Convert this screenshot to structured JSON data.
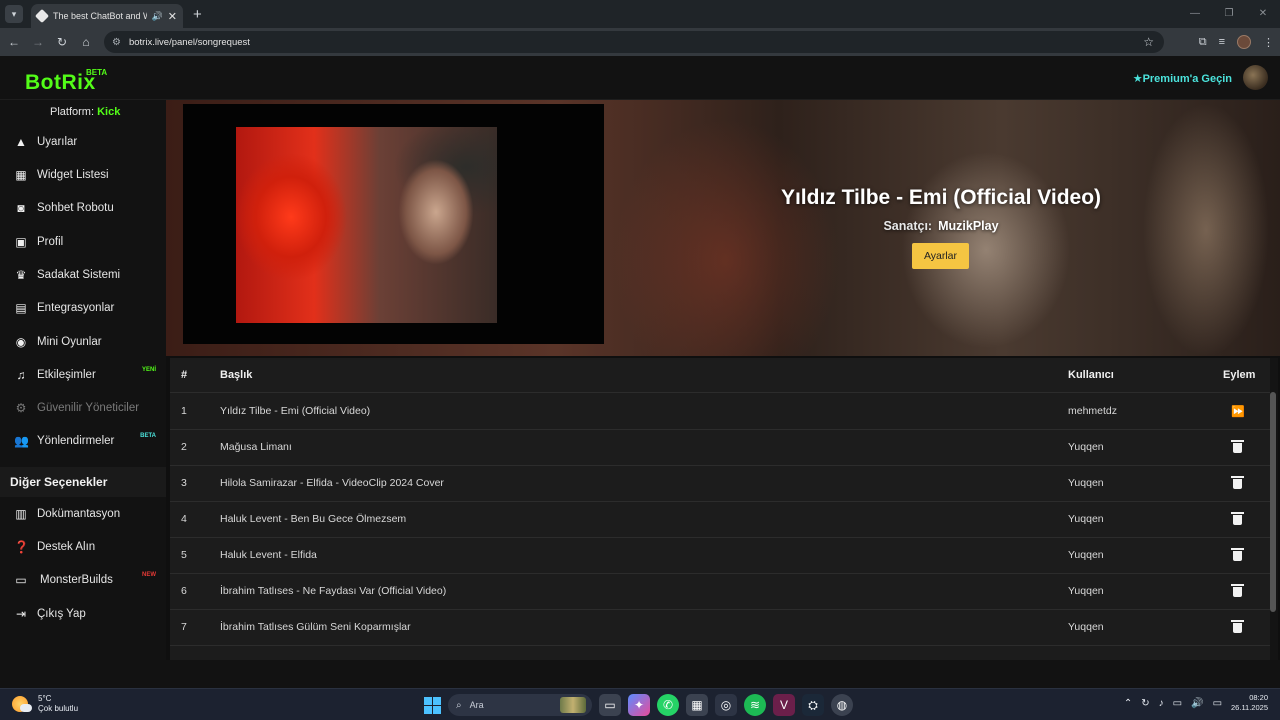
{
  "browser": {
    "tab_title": "The best ChatBot and Widg",
    "url": "botrix.live/panel/songrequest"
  },
  "header": {
    "logo": "BotRix",
    "beta": "BETA",
    "premium": "★Premium'a Geçin"
  },
  "sidebar": {
    "platform_label": "Platform:",
    "platform_value": "Kick",
    "items": [
      {
        "label": "Uyarılar",
        "icon": "warning-icon"
      },
      {
        "label": "Widget Listesi",
        "icon": "grid-icon"
      },
      {
        "label": "Sohbet Robotu",
        "icon": "robot-icon"
      },
      {
        "label": "Profil",
        "icon": "profile-card-icon"
      },
      {
        "label": "Sadakat Sistemi",
        "icon": "trophy-icon"
      },
      {
        "label": "Entegrasyonlar",
        "icon": "integration-icon"
      },
      {
        "label": "Mini Oyunlar",
        "icon": "gamepad-icon"
      },
      {
        "label": "Etkileşimler",
        "icon": "music-icon",
        "tag": "YENİ"
      },
      {
        "label": "Güvenilir Yöneticiler",
        "icon": "shield-icon"
      },
      {
        "label": "Yönlendirmeler",
        "icon": "users-icon",
        "tag": "BETA"
      }
    ],
    "section_title": "Diğer Seçenekler",
    "other_items": [
      {
        "label": "Dokümantasyon",
        "icon": "docs-icon"
      },
      {
        "label": "Destek Alın",
        "icon": "help-icon"
      },
      {
        "label": "MonsterBuilds",
        "icon": "laptop-icon",
        "tag": "NEW"
      },
      {
        "label": "Çıkış Yap",
        "icon": "logout-icon"
      }
    ]
  },
  "now_playing": {
    "title": "Yıldız Tilbe - Emi (Official Video)",
    "artist_label": "Sanatçı:",
    "artist": "MuzikPlay",
    "settings_button": "Ayarlar"
  },
  "table": {
    "headers": {
      "num": "#",
      "title": "Başlık",
      "user": "Kullanıcı",
      "action": "Eylem"
    },
    "rows": [
      {
        "num": "1",
        "title": "Yıldız Tilbe - Emi (Official Video)",
        "user": "mehmetdz",
        "action": "skip"
      },
      {
        "num": "2",
        "title": "Mağusa Limanı",
        "user": "Yuqqen",
        "action": "delete"
      },
      {
        "num": "3",
        "title": "Hilola Samirazar - Elfida - VideoClip 2024 Cover",
        "user": "Yuqqen",
        "action": "delete"
      },
      {
        "num": "4",
        "title": "Haluk Levent - Ben Bu Gece Ölmezsem",
        "user": "Yuqqen",
        "action": "delete"
      },
      {
        "num": "5",
        "title": "Haluk Levent - Elfida",
        "user": "Yuqqen",
        "action": "delete"
      },
      {
        "num": "6",
        "title": "İbrahim Tatlıses - Ne Faydası Var (Official Video)",
        "user": "Yuqqen",
        "action": "delete"
      },
      {
        "num": "7",
        "title": "İbrahim Tatlıses Gülüm Seni Koparmışlar",
        "user": "Yuqqen",
        "action": "delete"
      }
    ]
  },
  "taskbar": {
    "temp": "5°C",
    "weather": "Çok bulutlu",
    "search_placeholder": "Ara",
    "time": "08:20",
    "date": "26.11.2025"
  }
}
